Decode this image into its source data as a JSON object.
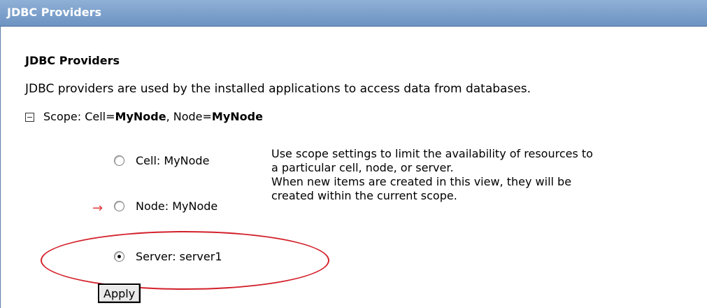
{
  "titlebar": {
    "title": "JDBC Providers"
  },
  "section": {
    "heading": "JDBC Providers",
    "description": "JDBC providers are used by the installed applications to access data from databases."
  },
  "scope": {
    "prefix": "Scope: Cell=",
    "cell_value": "MyNode",
    "separator": ", Node=",
    "node_value": "MyNode"
  },
  "options": {
    "cell": "Cell: MyNode",
    "node": "Node: MyNode",
    "server": "Server: server1",
    "selected": "server"
  },
  "help": {
    "line1": "Use scope settings to limit the availability of resources to",
    "line2": "a particular cell, node, or server.",
    "line3": "When new items are created in this view, they will be",
    "line4": "created within the current scope."
  },
  "current_indicator": "→",
  "apply_label": "Apply",
  "colors": {
    "titlebar": "#7ca2cd",
    "annotation": "#d3202a",
    "current_arrow": "#e23a3a"
  }
}
